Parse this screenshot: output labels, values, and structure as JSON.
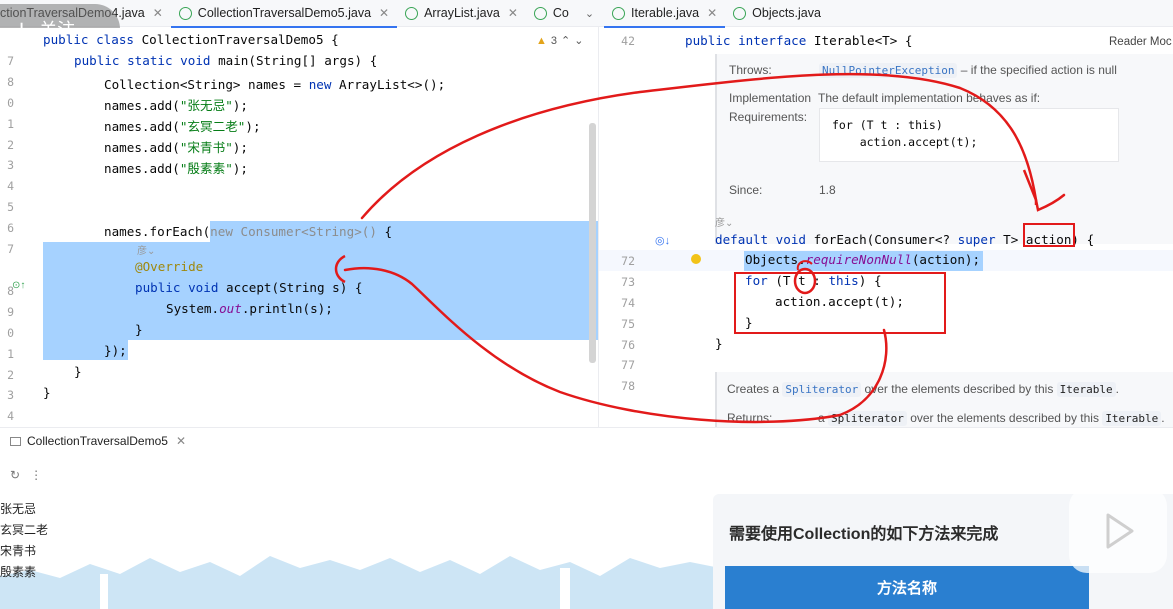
{
  "overlay": {
    "follow_label": "关注"
  },
  "left_tabs": [
    {
      "label": "ctionTraversalDemo4.java"
    },
    {
      "label": "CollectionTraversalDemo5.java"
    },
    {
      "label": "ArrayList.java"
    },
    {
      "label": "Co"
    }
  ],
  "right_tabs": [
    {
      "label": "Iterable.java"
    },
    {
      "label": "Objects.java"
    }
  ],
  "left_editor": {
    "warning_count": "3",
    "line_numbers": [
      "7",
      "8",
      "0",
      "1",
      "2",
      "3",
      "4",
      "5",
      "6",
      "7",
      "",
      "8",
      "9",
      "0",
      "1",
      "2",
      "3",
      "4",
      "5"
    ],
    "code": {
      "class_decl": {
        "kw": "public class ",
        "name": "CollectionTraversalDemo5 {"
      },
      "main_decl": {
        "kw": "public static void ",
        "name": "main(String[] args) {"
      },
      "names_decl": {
        "a": "Collection<String> names = ",
        "kw": "new",
        "b": " ArrayList<>();"
      },
      "add_prefix": "names.add(",
      "add_suffix": ");",
      "strings": [
        "\"张无忌\"",
        "\"玄冥二老\"",
        "\"宋青书\"",
        "\"殷素素\""
      ],
      "foreach_prefix": "names.forEach(",
      "foreach_gray": "new Consumer<String>()",
      "foreach_suffix": " {",
      "override": "@Override",
      "accept_kw": "public void ",
      "accept_name": "accept(String s) {",
      "println_a": "System.",
      "println_out": "out",
      "println_b": ".println(s);",
      "close_brace": "}",
      "close_paren": "});",
      "close_brace2": "}",
      "close_brace3": "}"
    }
  },
  "right_editor": {
    "reader_mode": "Reader Moc",
    "line42": "42",
    "iface_kw": "public interface ",
    "iface_name": "Iterable<T> {",
    "doc": {
      "throws_label": "Throws:",
      "throws_chip": "NullPointerException",
      "throws_text": " – if the specified action is null",
      "impl_label": "Implementation",
      "impl_text": "The default implementation behaves as if:",
      "req_label": "Requirements:",
      "impl_code1": "for (T t : this)",
      "impl_code2": "    action.accept(t);",
      "since_label": "Since:",
      "since_val": "1.8",
      "creates_a": "Creates a ",
      "creates_chip": "Spliterator",
      "creates_b": " over the elements described by this ",
      "creates_chip2": "Iterable",
      "creates_c": ".",
      "returns_label": "Returns:",
      "returns_a": "a ",
      "returns_chip": "Spliterator",
      "returns_b": " over the elements described by this ",
      "returns_chip2": "Iterable",
      "returns_c": "."
    },
    "line_numbers": [
      "72",
      "73",
      "74",
      "75",
      "76",
      "77",
      "78"
    ],
    "code": {
      "def_kw": "default void ",
      "def_name": "forEach(Consumer<? ",
      "def_super": "super",
      "def_t": " T> ",
      "def_action": "action",
      "def_end": ") {",
      "req_a": "Objects.",
      "req_it": "requireNonNull",
      "req_b": "(action);",
      "for_kw": "for",
      "for_a": " (T ",
      "for_t": "t",
      "for_b": " : ",
      "for_this": "this",
      "for_c": ") {",
      "accept": "action.accept(t);",
      "close": "}",
      "close2": "}"
    }
  },
  "run_panel": {
    "tab_label": "CollectionTraversalDemo5",
    "output": [
      "张无忌",
      "玄冥二老",
      "宋青书",
      "殷素素"
    ]
  },
  "slide_overlay": {
    "title": "需要使用Collection的如下方法来完成",
    "header": "方法名称"
  },
  "colors": {
    "annotation_red": "#e21a1a",
    "selection": "#a6d2ff",
    "accent": "#3574f0"
  }
}
